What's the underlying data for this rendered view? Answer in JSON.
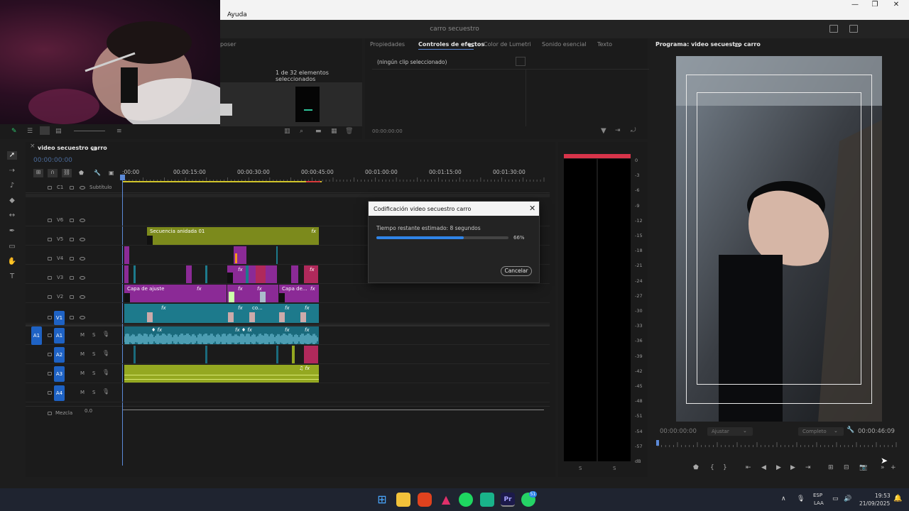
{
  "menu": {
    "item": "Ayuda"
  },
  "window": {
    "title": "carro secuestro"
  },
  "top_left_panel": {
    "tab_partial": "poser",
    "selection_count": "1 de 32 elementos seleccionados"
  },
  "effects_panel": {
    "tabs": [
      "Propiedades",
      "Controles de efectos",
      "Color de Lumetri",
      "Sonido esencial",
      "Texto"
    ],
    "active_tab": "Controles de efectos",
    "no_clip": "(ningún clip seleccionado)",
    "timecode": "00:00:00:00"
  },
  "program_monitor": {
    "title": "Programa: video secuestro carro",
    "timecode_left": "00:00:00:00",
    "fit_dropdown": "Ajustar",
    "quality_dropdown": "Completo",
    "timecode_right": "00:00:46:09"
  },
  "timeline": {
    "sequence_name": "video secuestro carro",
    "timecode": "00:00:00:00",
    "ruler": [
      ":00:00",
      "00:00:15:00",
      "00:00:30:00",
      "00:00:45:00",
      "00:01:00:00",
      "00:01:15:00",
      "00:01:30:00"
    ],
    "subtitle_track": {
      "id": "C1",
      "label": "Subtítulo"
    },
    "video_tracks": [
      "V6",
      "V5",
      "V4",
      "V3",
      "V2",
      "V1"
    ],
    "audio_tracks": [
      "A1",
      "A2",
      "A3",
      "A4"
    ],
    "source_patch_audio": "A1",
    "mix_track": {
      "label": "Mezcla",
      "value": "0.0"
    },
    "clips": {
      "nested": "Secuencia anidada 01",
      "adjust1": "Capa de ajuste",
      "adjust2": "Capa de...",
      "co": "co..."
    },
    "clip_mark": "M",
    "clip_solo": "S"
  },
  "audio_meter": {
    "scale": [
      "0",
      "-3",
      "-6",
      "-9",
      "-12",
      "-15",
      "-18",
      "-21",
      "-24",
      "-27",
      "-30",
      "-33",
      "-36",
      "-39",
      "-42",
      "-45",
      "-48",
      "-51",
      "-54",
      "-57",
      "dB"
    ],
    "channel_labels": [
      "S",
      "S"
    ]
  },
  "dialog": {
    "title": "Codificación video secuestro carro",
    "remaining": "Tiempo restante estimado: 8 segundos",
    "percent_label": "66%",
    "progress": 0.66,
    "cancel_label": "Cancelar"
  },
  "taskbar": {
    "lang": "ESP",
    "lang_sub": "LAA",
    "time": "19:53",
    "date": "21/09/2025",
    "whatsapp_badge": "51"
  },
  "colors": {
    "accent_blue": "#1e62c4",
    "clip_magenta": "#8b2a96",
    "clip_teal": "#1d7a8c",
    "clip_olive": "#7c8a1c",
    "clip_green": "#94a821",
    "clip_red": "#b0295b"
  }
}
